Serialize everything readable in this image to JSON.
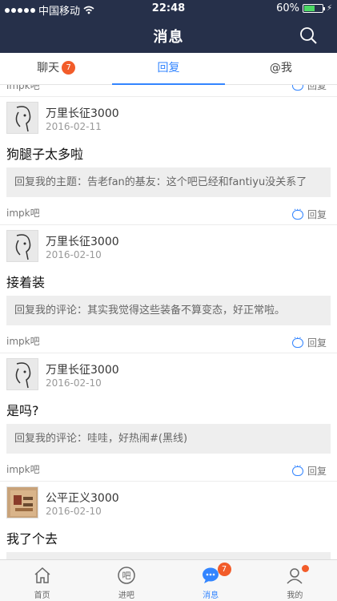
{
  "status_bar": {
    "carrier": "中国移动",
    "time": "22:48",
    "battery": "60%",
    "battery_level": 0.6
  },
  "nav": {
    "title": "消息",
    "search_icon": "search-icon"
  },
  "tabs": [
    {
      "label": "聊天",
      "badge": "7"
    },
    {
      "label": "回复",
      "active": true
    },
    {
      "label": "@我"
    }
  ],
  "partial_top": {
    "forum": "impk吧",
    "reply_label": "回复"
  },
  "items": [
    {
      "user": "万里长征3000",
      "date": "2016-02-11",
      "content": "狗腿子太多啦",
      "quote": "回复我的主题：告老fan的基友：这个吧已经和fantiyu没关系了",
      "forum": "impk吧",
      "reply_label": "回复"
    },
    {
      "user": "万里长征3000",
      "date": "2016-02-10",
      "content": "接着装",
      "quote": "回复我的评论：其实我觉得这些装备不算变态，好正常啦。",
      "forum": "impk吧",
      "reply_label": "回复"
    },
    {
      "user": "万里长征3000",
      "date": "2016-02-10",
      "content": "是吗?",
      "quote": "回复我的评论：哇哇，好热闹#(黑线)",
      "forum": "impk吧",
      "reply_label": "回复"
    },
    {
      "user": "公平正义3000",
      "date": "2016-02-10",
      "content": "我了个去",
      "quote": "",
      "forum": "",
      "reply_label": ""
    }
  ],
  "bottom_tabs": [
    {
      "label": "首页",
      "icon": "home-icon"
    },
    {
      "label": "进吧",
      "icon": "forum-icon"
    },
    {
      "label": "消息",
      "icon": "message-icon",
      "badge": "7",
      "active": true
    },
    {
      "label": "我的",
      "icon": "profile-icon"
    }
  ],
  "colors": {
    "nav_bg": "#26304a",
    "accent": "#3385ff",
    "badge": "#f25c2a"
  }
}
